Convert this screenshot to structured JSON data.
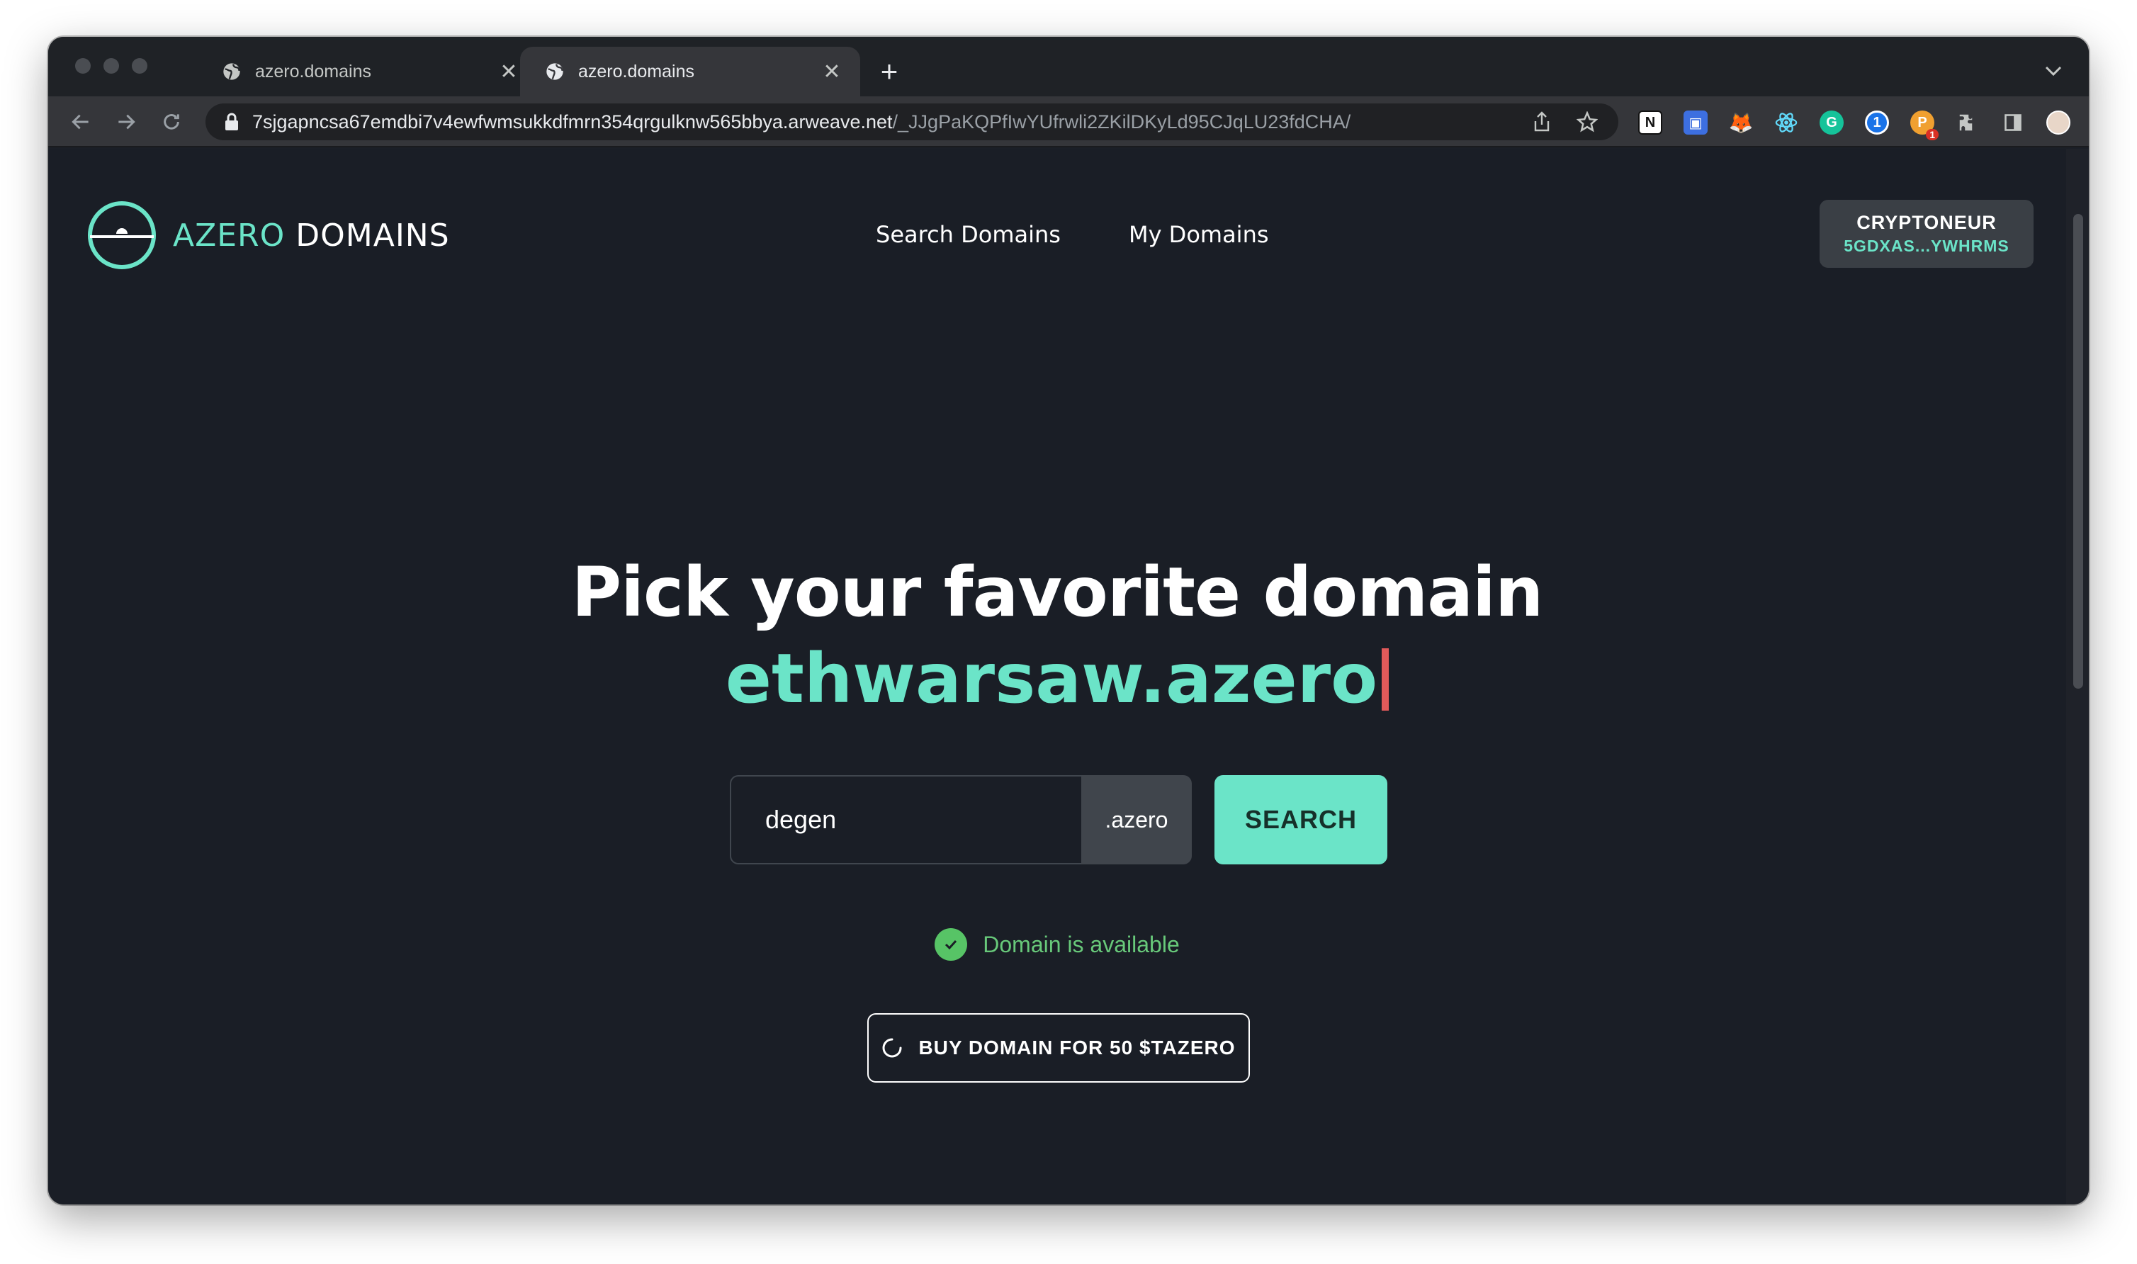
{
  "browser": {
    "tabs": [
      {
        "title": "azero.domains",
        "active": false
      },
      {
        "title": "azero.domains",
        "active": true
      }
    ],
    "url_host": "7sjgapncsa67emdbi7v4ewfwmsukkdfmrn354qrgulknw565bbya.arweave.net",
    "url_path": "/_JJgPaKQPfIwYUfrwli2ZKilDKyLd95CJqLU23fdCHA/",
    "extension_badge": "1"
  },
  "header": {
    "logo_primary": "AZERO",
    "logo_secondary": "DOMAINS",
    "nav": [
      "Search Domains",
      "My Domains"
    ],
    "account_name": "CRYPTONEUR",
    "account_address": "5GDXAS...YWHRMS"
  },
  "hero": {
    "title": "Pick your favorite domain",
    "example_domain": "ethwarsaw.azero"
  },
  "search": {
    "value": "degen",
    "suffix": ".azero",
    "button_label": "SEARCH"
  },
  "result": {
    "status_text": "Domain is available",
    "buy_label": "BUY DOMAIN FOR 50 $TAZERO"
  },
  "colors": {
    "accent": "#6be4c8",
    "background": "#1a1e26",
    "success": "#57c466",
    "caret": "#e25a5a"
  }
}
